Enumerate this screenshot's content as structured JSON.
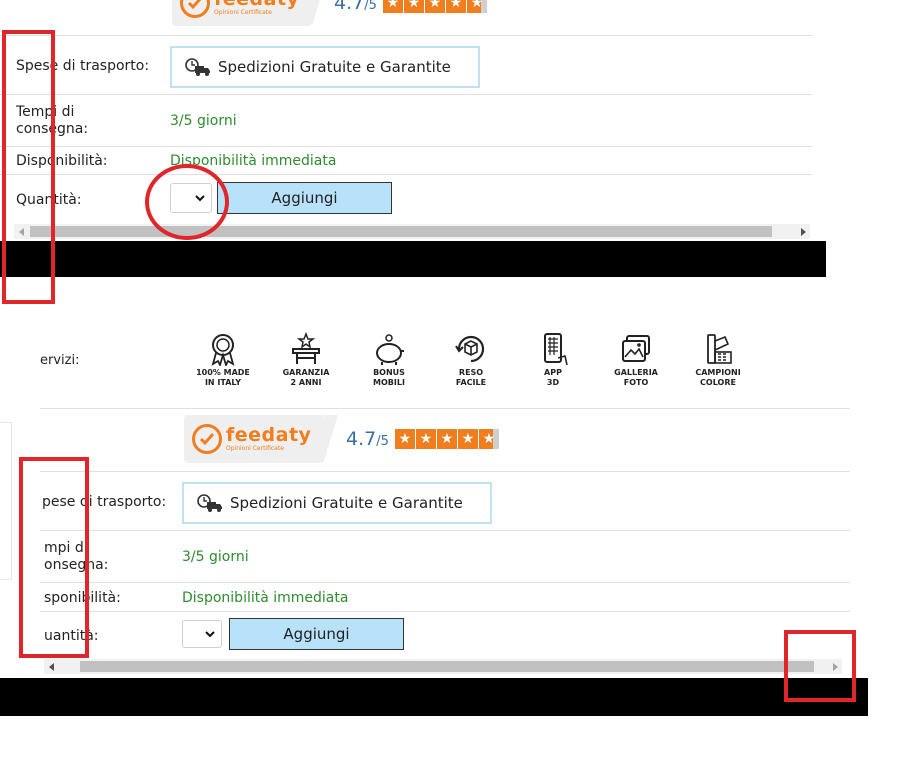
{
  "feedaty": {
    "name": "feedaty",
    "sub": "Opinioni Certificate",
    "score": "4.7",
    "out_of": "/5",
    "stars": "★"
  },
  "panel_top": {
    "shipping_label": "Spese di trasporto:",
    "shipping_value": "Spedizioni Gratuite e Garantite",
    "delivery_label_1": "Tempi di",
    "delivery_label_2": "consegna:",
    "delivery_value": "3/5 giorni",
    "availability_label": "Disponibilità:",
    "availability_value": "Disponibilità immediata",
    "quantity_label": "Quantità:",
    "add_button": "Aggiungi"
  },
  "panel_bottom": {
    "services_label": "ervizi:",
    "services": [
      {
        "line1": "100% MADE",
        "line2": "IN ITALY",
        "icon": "award-ribbon-icon"
      },
      {
        "line1": "GARANZIA",
        "line2": "2 ANNI",
        "icon": "warranty-table-icon"
      },
      {
        "line1": "BONUS",
        "line2": "MOBILI",
        "icon": "piggy-bank-icon"
      },
      {
        "line1": "RESO",
        "line2": "FACILE",
        "icon": "return-box-icon"
      },
      {
        "line1": "APP",
        "line2": "3D",
        "icon": "phone-app-icon"
      },
      {
        "line1": "GALLERIA",
        "line2": "FOTO",
        "icon": "photo-gallery-icon"
      },
      {
        "line1": "CAMPIONI",
        "line2": "COLORE",
        "icon": "color-swatch-icon"
      }
    ],
    "shipping_label": "pese di trasporto:",
    "shipping_value": "Spedizioni Gratuite e Garantite",
    "delivery_label_1": "mpi di",
    "delivery_label_2": "onsegna:",
    "delivery_value": "3/5 giorni",
    "availability_label": "sponibilità:",
    "availability_value": "Disponibilità immediata",
    "quantity_label": "uantità:",
    "add_button": "Aggiungi"
  },
  "colors": {
    "accent_orange": "#f07d1e",
    "score_blue": "#3a6ea5",
    "button_blue": "#b8e2fa",
    "green_text": "#2e8b2e",
    "annotation_red": "#e0252b"
  }
}
